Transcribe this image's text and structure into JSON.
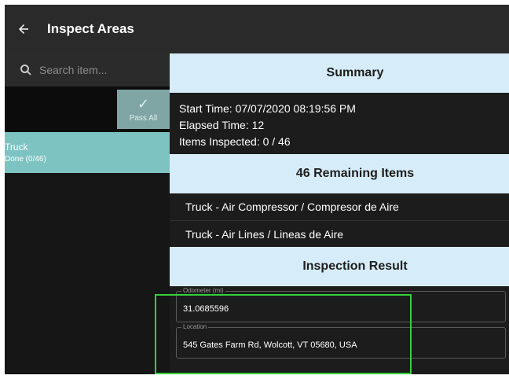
{
  "header": {
    "back_icon": "arrow-left-icon",
    "title": "Inspect Areas"
  },
  "search": {
    "icon": "search-icon",
    "placeholder": "Search item..."
  },
  "pass_all": {
    "icon": "check-icon",
    "label": "Pass All"
  },
  "areas": [
    {
      "name": "Truck",
      "status": "Done (0/46)"
    }
  ],
  "summary": {
    "title": "Summary",
    "start_time": "Start Time: 07/07/2020 08:19:56 PM",
    "elapsed_time": "Elapsed Time: 12",
    "items_inspected": "Items Inspected: 0 / 46"
  },
  "remaining": {
    "title": "46 Remaining Items",
    "items": [
      "Truck - Air Compressor / Compresor de Aire",
      "Truck - Air Lines / Lineas de Aire"
    ]
  },
  "inspection_result": {
    "title": "Inspection Result",
    "odometer": {
      "label": "Odometer (mi)",
      "value": "31.0685596"
    },
    "location": {
      "label": "Location",
      "value": "545 Gates Farm Rd, Wolcott, VT 05680, USA"
    }
  },
  "colors": {
    "topbar": "#2a2a2a",
    "header_band": "#d6ecf8",
    "selected_area": "#7dc3c2",
    "highlight": "#34d13c"
  }
}
